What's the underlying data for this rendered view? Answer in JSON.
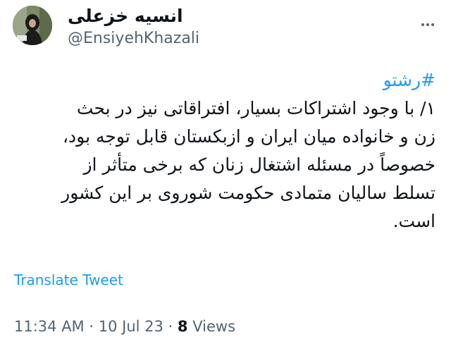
{
  "author": {
    "display_name": "انسیه خزعلی",
    "handle": "@EnsiyehKhazali"
  },
  "tweet": {
    "hashtag": "#رشتو",
    "lines": [
      "۱/ با وجود اشتراکات بسیار، افتراقاتی نیز در بحث",
      "زن و خانواده میان ایران و ازبکستان  قابل توجه بود،",
      "خصوصاً در مسئله اشتغال زنان که برخی متأثر از",
      "تسلط سالیان متمادی حکومت شوروی بر این کشور",
      "است."
    ]
  },
  "translate_label": "Translate Tweet",
  "meta": {
    "time": "11:34 AM",
    "date": "10 Jul 23",
    "views_count": "8",
    "views_label": "Views"
  },
  "colors": {
    "link": "#1d9bf0",
    "secondary": "#536471",
    "text": "#0f1419"
  },
  "icons": {
    "more": "more-horizontal-icon"
  }
}
